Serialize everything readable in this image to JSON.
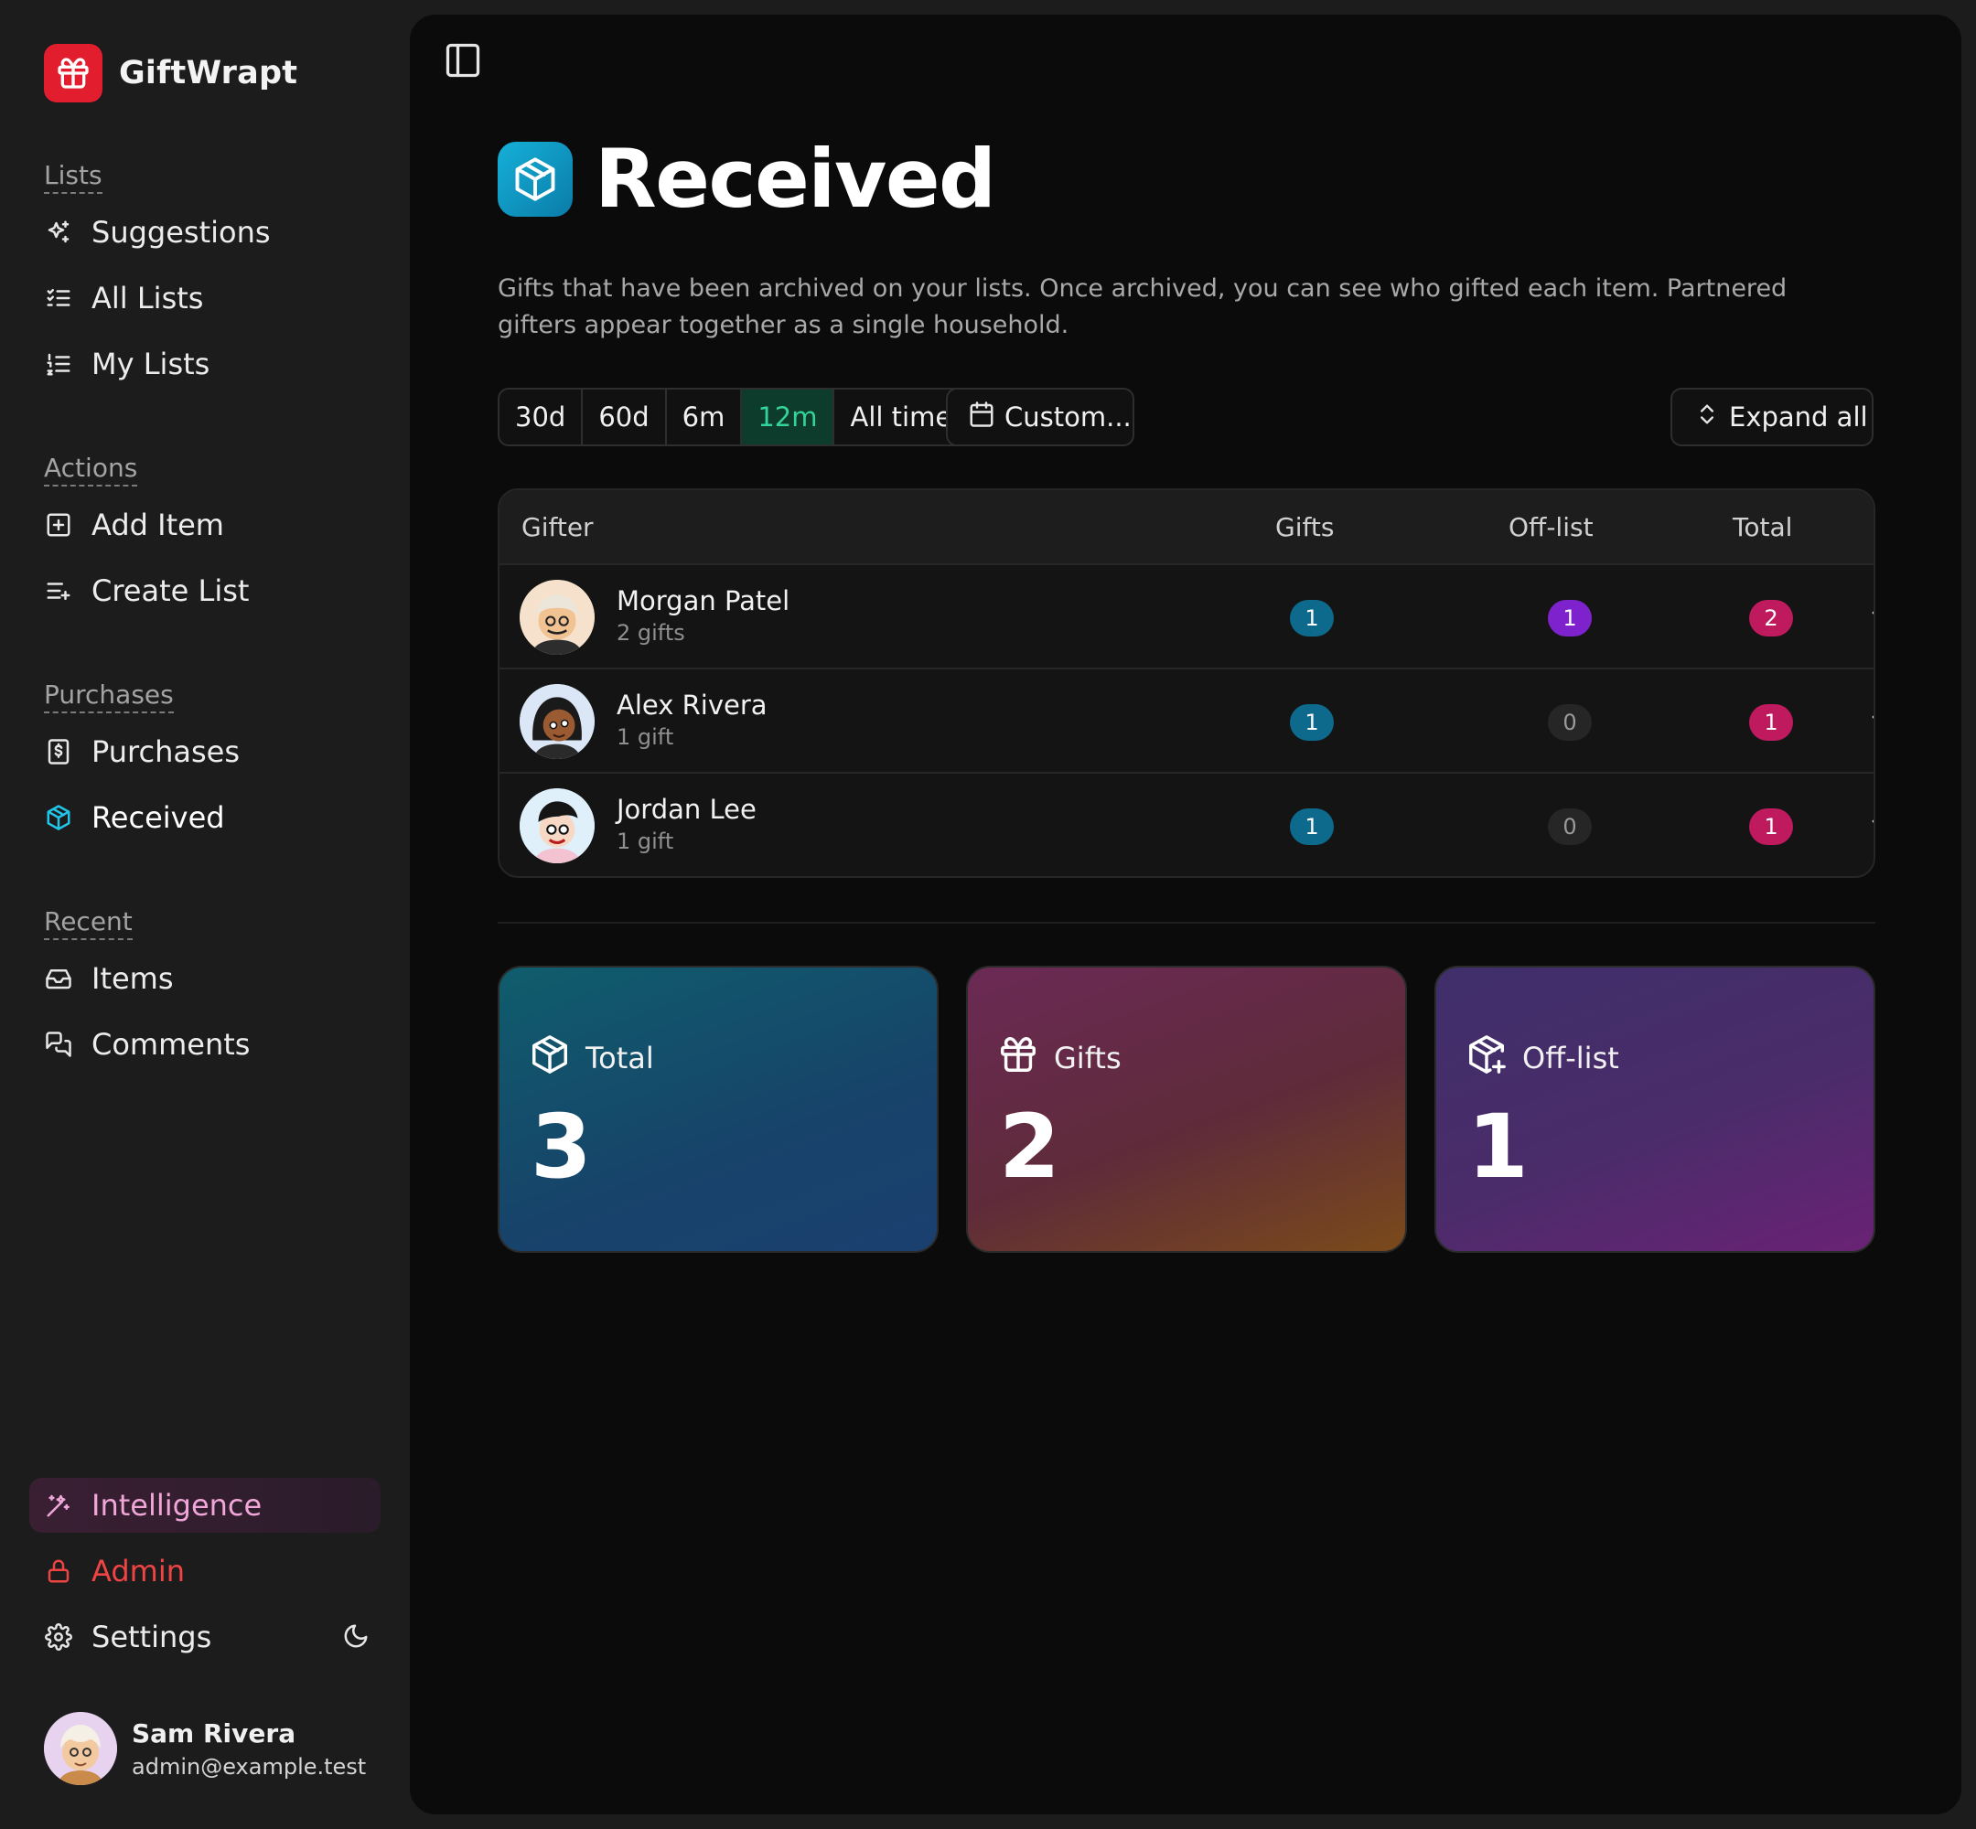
{
  "app": {
    "name": "GiftWrapt",
    "brand_color": "#e11d2e"
  },
  "sidebar": {
    "sections": {
      "lists": "Lists",
      "actions": "Actions",
      "purchases": "Purchases",
      "recent": "Recent"
    },
    "items": {
      "suggestions": "Suggestions",
      "all_lists": "All Lists",
      "my_lists": "My Lists",
      "add_item": "Add Item",
      "create_list": "Create List",
      "purchases": "Purchases",
      "received": "Received",
      "items": "Items",
      "comments": "Comments",
      "intelligence": "Intelligence",
      "admin": "Admin",
      "settings": "Settings"
    },
    "user": {
      "name": "Sam Rivera",
      "email": "admin@example.test"
    }
  },
  "page": {
    "title": "Received",
    "description": "Gifts that have been archived on your lists. Once archived, you can see who gifted each item. Partnered gifters appear together as a single household."
  },
  "filters": {
    "ranges": [
      "30d",
      "60d",
      "6m",
      "12m",
      "All time"
    ],
    "active_range": "12m",
    "custom_label": "Custom...",
    "expand_label": "Expand all"
  },
  "table": {
    "headers": {
      "gifter": "Gifter",
      "gifts": "Gifts",
      "offlist": "Off-list",
      "total": "Total"
    },
    "rows": [
      {
        "name": "Morgan Patel",
        "sub": "2 gifts",
        "gifts": "1",
        "offlist": "1",
        "total": "2"
      },
      {
        "name": "Alex Rivera",
        "sub": "1 gift",
        "gifts": "1",
        "offlist": "0",
        "total": "1"
      },
      {
        "name": "Jordan Lee",
        "sub": "1 gift",
        "gifts": "1",
        "offlist": "0",
        "total": "1"
      }
    ]
  },
  "stats": {
    "total": {
      "label": "Total",
      "value": "3"
    },
    "gifts": {
      "label": "Gifts",
      "value": "2"
    },
    "offlist": {
      "label": "Off-list",
      "value": "1"
    }
  },
  "colors": {
    "accent_green": "#34d399",
    "badge_teal": "#0e6a8c",
    "badge_purple": "#7e22ce",
    "badge_pink": "#c01a5e",
    "admin_red": "#ef4444",
    "intelligence_pink": "#f0a6d8"
  }
}
